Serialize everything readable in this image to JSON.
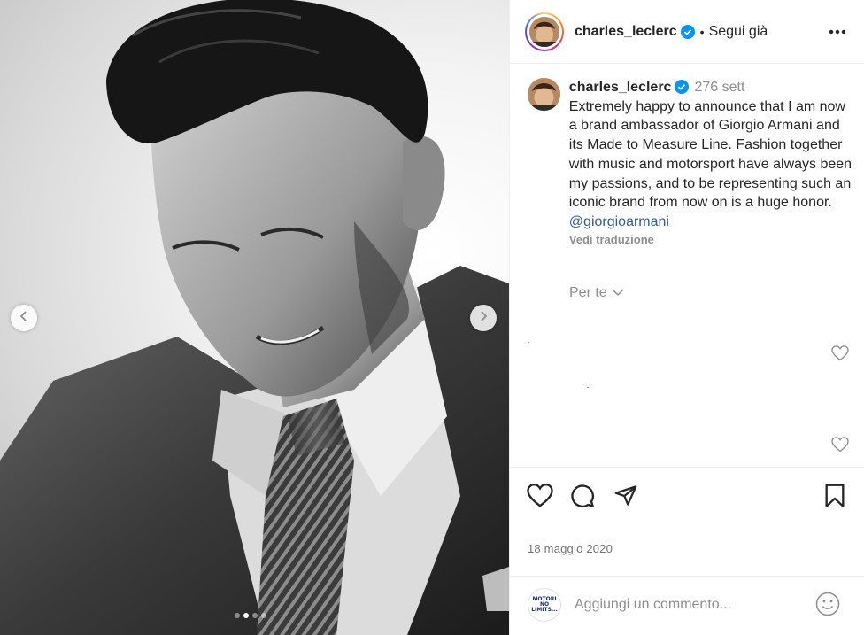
{
  "post": {
    "username": "charles_leclerc",
    "follow_label": "Segui già",
    "bullet": "•",
    "verified": true
  },
  "caption": {
    "username": "charles_leclerc",
    "time": "276 sett",
    "text": "Extremely happy to announce that I am now a brand ambassador of Giorgio Armani and its Made to Measure Line. Fashion together with music and motorsport have always been my passions, and to be representing such an iconic brand from now on is a huge honor.",
    "mention": "@giorgioarmani",
    "translate_label": "Vedi traduzione"
  },
  "for_you": {
    "label": "Per te"
  },
  "date": "18 maggio 2020",
  "comment": {
    "placeholder": "Aggiungi un commento...",
    "avatar_text_line1": "MOTORI",
    "avatar_text_line2": "NO",
    "avatar_text_line3": "LIMITS..."
  },
  "carousel": {
    "total": 4,
    "active_index": 1
  },
  "colors": {
    "text": "#262626",
    "muted": "#8e8e8e",
    "link": "#385898",
    "verified": "#0095f6",
    "divider": "#efefef"
  },
  "icons": {
    "header_more": "more-horizontal-icon",
    "like": "heart-icon",
    "comment": "comment-icon",
    "share": "send-icon",
    "save": "bookmark-icon",
    "emoji": "emoji-icon",
    "prev": "chevron-left-icon",
    "next": "chevron-right-icon"
  }
}
